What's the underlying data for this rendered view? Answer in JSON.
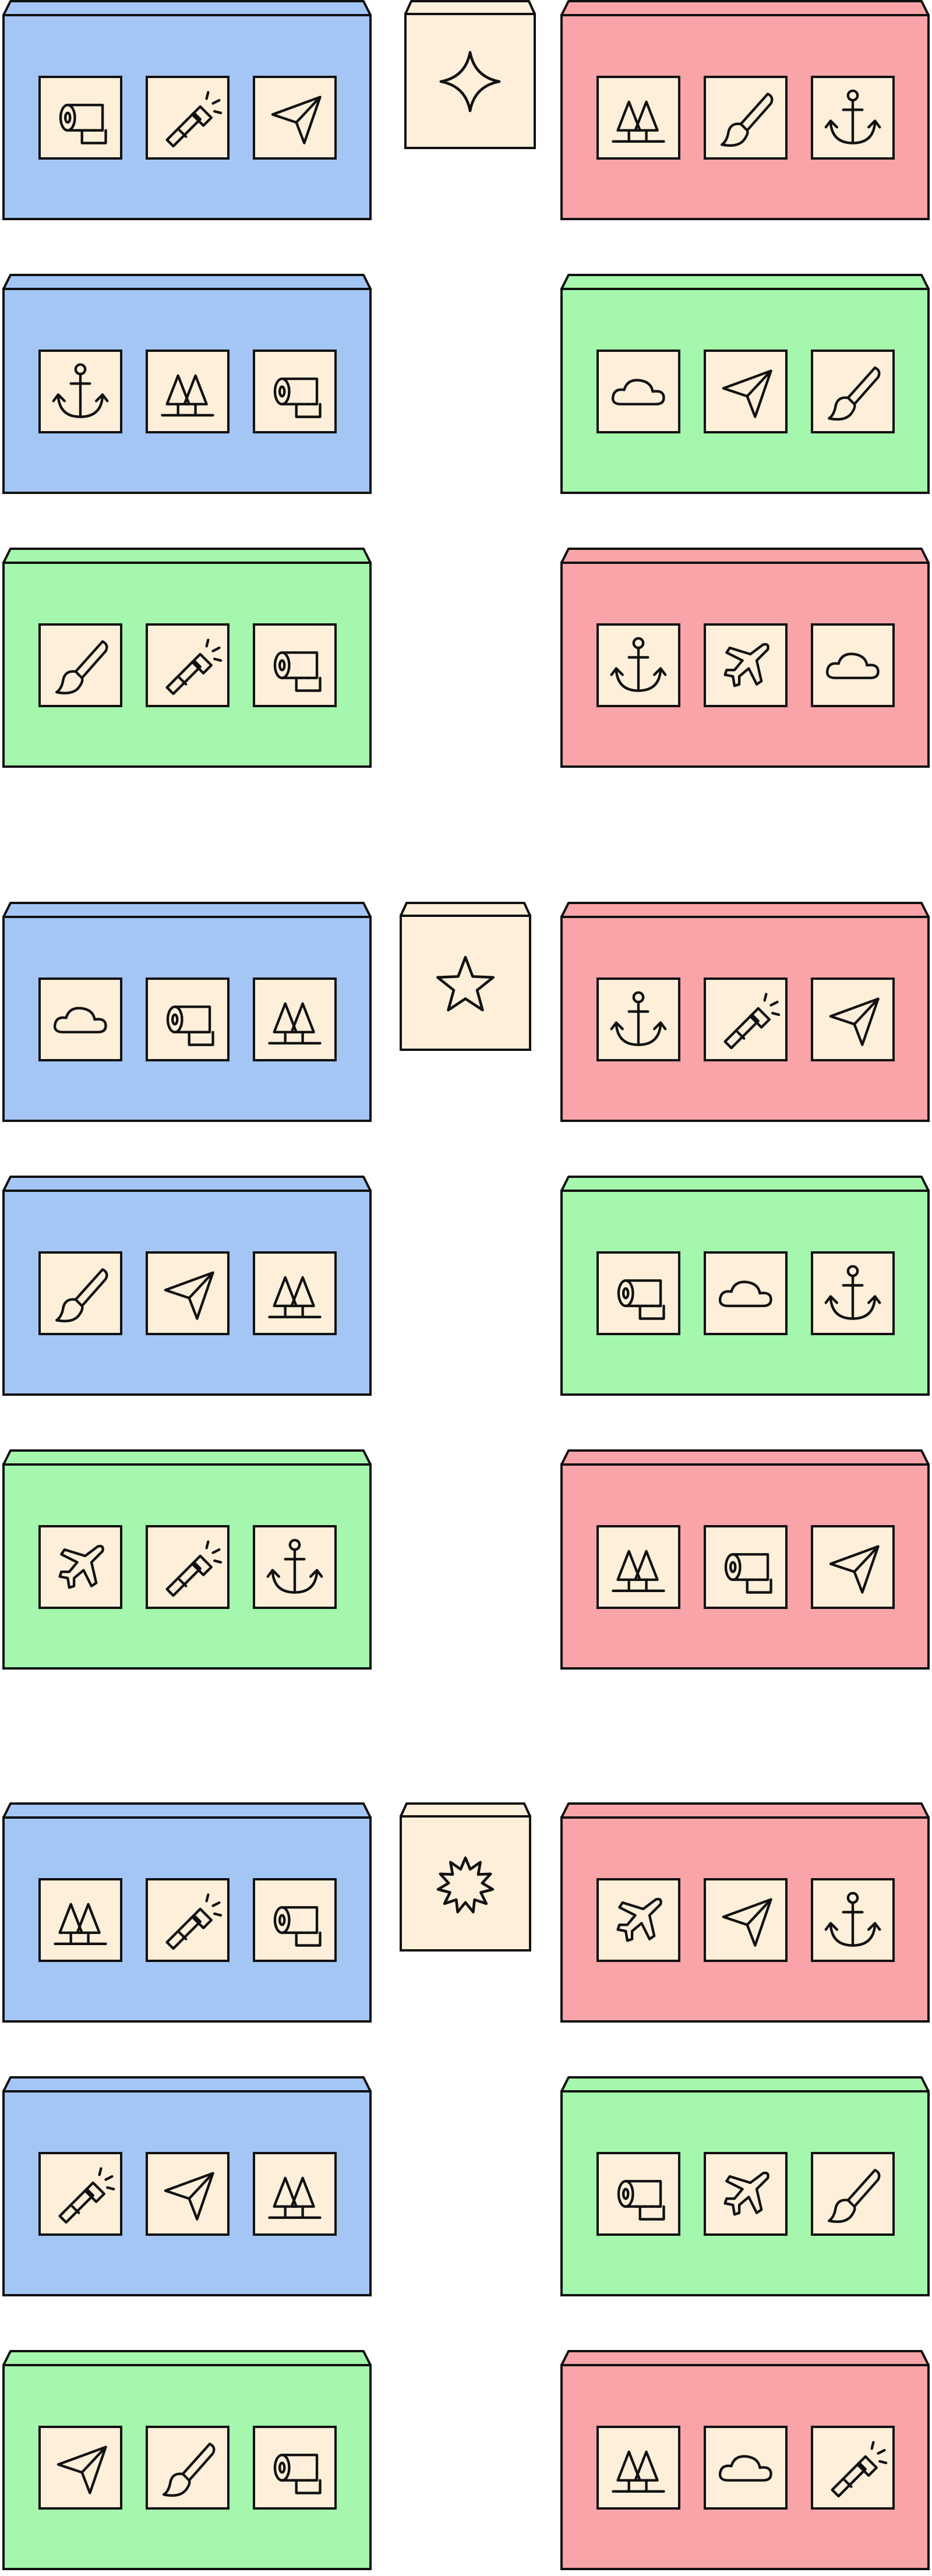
{
  "colors": {
    "blue": "#a4c6f5",
    "green": "#a4f7ac",
    "red": "#f9a4a8",
    "tile": "#fdefd9",
    "outline": "#111111"
  },
  "groups": [
    {
      "key_icon": "four-point-star-icon",
      "rows": [
        {
          "left": {
            "color": "blue",
            "icons": [
              "toilet-paper-icon",
              "flashlight-icon",
              "paper-plane-icon"
            ]
          },
          "right": {
            "color": "red",
            "icons": [
              "trees-icon",
              "paintbrush-icon",
              "anchor-icon"
            ]
          }
        },
        {
          "left": {
            "color": "blue",
            "icons": [
              "anchor-icon",
              "trees-icon",
              "toilet-paper-icon"
            ]
          },
          "right": {
            "color": "green",
            "icons": [
              "cloud-icon",
              "paper-plane-icon",
              "paintbrush-icon"
            ]
          }
        },
        {
          "left": {
            "color": "green",
            "icons": [
              "paintbrush-icon",
              "flashlight-icon",
              "toilet-paper-icon"
            ]
          },
          "right": {
            "color": "red",
            "icons": [
              "anchor-icon",
              "airplane-icon",
              "cloud-icon"
            ]
          }
        }
      ]
    },
    {
      "key_icon": "five-point-star-icon",
      "rows": [
        {
          "left": {
            "color": "blue",
            "icons": [
              "cloud-icon",
              "toilet-paper-icon",
              "trees-icon"
            ]
          },
          "right": {
            "color": "red",
            "icons": [
              "anchor-icon",
              "flashlight-icon",
              "paper-plane-icon"
            ]
          }
        },
        {
          "left": {
            "color": "blue",
            "icons": [
              "paintbrush-icon",
              "paper-plane-icon",
              "trees-icon"
            ]
          },
          "right": {
            "color": "green",
            "icons": [
              "toilet-paper-icon",
              "cloud-icon",
              "anchor-icon"
            ]
          }
        },
        {
          "left": {
            "color": "green",
            "icons": [
              "airplane-icon",
              "flashlight-icon",
              "anchor-icon"
            ]
          },
          "right": {
            "color": "red",
            "icons": [
              "trees-icon",
              "toilet-paper-icon",
              "paper-plane-icon"
            ]
          }
        }
      ]
    },
    {
      "key_icon": "starburst-icon",
      "rows": [
        {
          "left": {
            "color": "blue",
            "icons": [
              "trees-icon",
              "flashlight-icon",
              "toilet-paper-icon"
            ]
          },
          "right": {
            "color": "red",
            "icons": [
              "airplane-icon",
              "paper-plane-icon",
              "anchor-icon"
            ]
          }
        },
        {
          "left": {
            "color": "blue",
            "icons": [
              "flashlight-icon",
              "paper-plane-icon",
              "trees-icon"
            ]
          },
          "right": {
            "color": "green",
            "icons": [
              "toilet-paper-icon",
              "airplane-icon",
              "paintbrush-icon"
            ]
          }
        },
        {
          "left": {
            "color": "green",
            "icons": [
              "paper-plane-icon",
              "paintbrush-icon",
              "toilet-paper-icon"
            ]
          },
          "right": {
            "color": "red",
            "icons": [
              "trees-icon",
              "cloud-icon",
              "flashlight-icon"
            ]
          }
        }
      ]
    }
  ]
}
